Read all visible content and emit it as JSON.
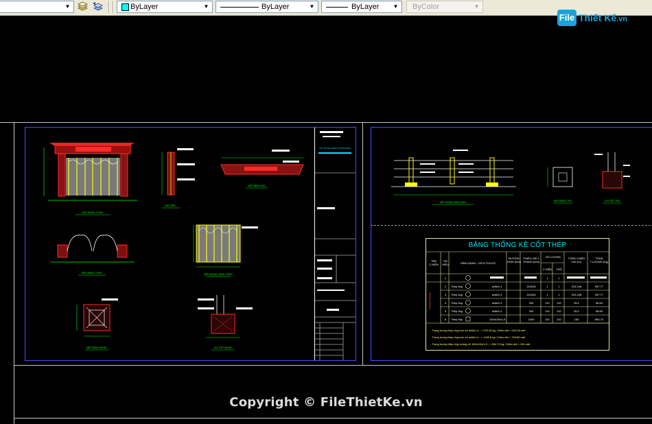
{
  "toolbar": {
    "layer_combo": "",
    "color": {
      "label": "ByLayer",
      "swatch": "#00ffff"
    },
    "linetype": {
      "label": "ByLayer"
    },
    "lineweight": {
      "label": "ByLayer"
    },
    "plotstyle": {
      "label": "ByColor"
    }
  },
  "logo": {
    "file": "File",
    "rest": "Thiết Kế",
    "domain": ".vn"
  },
  "sheets": [
    {
      "views": [
        {
          "title": "MẶT ĐỨNG CỔNG"
        },
        {
          "title": "MẶT BÊN"
        },
        {
          "title": "MẶT BẰNG MÁI"
        },
        {
          "title": "MẶT BẰNG CỔNG"
        },
        {
          "title": "MẶT ĐỨNG CÁNH CỔNG"
        },
        {
          "title": "MẶT BẰNG MÓNG"
        },
        {
          "title": "CHI TIẾT MÓNG"
        }
      ],
      "title_block": {
        "heading": "XÂY DỰNG CỔNG TƯỜNG RÀO"
      }
    },
    {
      "views": [
        {
          "title": "MẶT ĐỨNG HÀNG RÀO"
        },
        {
          "title": "MẶT BẰNG TRỤ"
        },
        {
          "title": "CHI TIẾT TRỤ"
        }
      ]
    }
  ],
  "rebar_table": {
    "title": "BẢNG THỐNG KÊ CỐT THÉP",
    "headers": {
      "component": "TÊN C.KIỆN",
      "mark": "SỐ HIỆU",
      "shape": "HÌNH DẠNG - KÍCH THƯỚC",
      "diameter": "ĐƯỜNG KÍNH (mm)",
      "length": "CHIỀU DÀI 1 THANH (mm)",
      "quantity": "SỐ LƯỢNG",
      "qty_component": "C.KIỆN",
      "qty_total": "T.BỘ",
      "total_length": "TỔNG CHIỀU DÀI (m)",
      "total_weight": "TỔNG T.LƯỢNG (Kg)"
    },
    "component_name": "CÁNH CỔNG",
    "rows": [
      {
        "mark": "1",
        "desc": "",
        "size": "",
        "diameter": "",
        "length": "",
        "qty_c": "1",
        "qty_t": "1",
        "total_len": "",
        "weight": ""
      },
      {
        "mark": "2",
        "desc": "Thép ống",
        "size": "ø48x1.4",
        "diameter": "",
        "length": "224246",
        "qty_c": "1",
        "qty_t": "1",
        "total_len": "224.246",
        "weight": "537.77"
      },
      {
        "mark": "3",
        "desc": "Thép ống",
        "size": "ø48x1.4",
        "diameter": "",
        "length": "224246",
        "qty_c": "1",
        "qty_t": "1",
        "total_len": "224.246",
        "weight": "537.77"
      },
      {
        "mark": "4",
        "desc": "Thép ống",
        "size": "ø48x1.4",
        "diameter": "",
        "length": "320",
        "qty_c": "110",
        "qty_t": "110",
        "total_len": "35.2",
        "weight": "56.63"
      },
      {
        "mark": "5",
        "desc": "Thép ống",
        "size": "ø48x1.4",
        "diameter": "",
        "length": "320",
        "qty_c": "110",
        "qty_t": "110",
        "total_len": "35.2",
        "weight": "56.63"
      },
      {
        "mark": "6",
        "desc": "Thép hộp",
        "size": "100x100x1.8",
        "diameter": "",
        "length": "1400",
        "qty_c": "110",
        "qty_t": "110",
        "total_len": "154",
        "weight": "654.74"
      }
    ],
    "notes": [
      "- Trọng lượng thép ống tròn cỡ ø48x1.4 : = 575.26 kg; Chiều dài = 224.25 mét",
      "- Trọng lượng thép ống tròn cỡ ø48x1.4 : = 1185.8 kg; Chiều dài = 739.69 mét",
      "- Trọng lượng thép ống vuông cỡ 100x100x1.8 : = 654.74 kg; Chiều dài = 154 mét"
    ]
  },
  "watermark": {
    "text": "Copyright © FileThietKe.vn"
  },
  "colors": {
    "background": "#000000",
    "sheet_border": "#4a4aff",
    "structure": "#ff2a2a",
    "dimension": "#00ff00",
    "gate_bar": "#ffff00",
    "table_title": "#00e5ff"
  }
}
